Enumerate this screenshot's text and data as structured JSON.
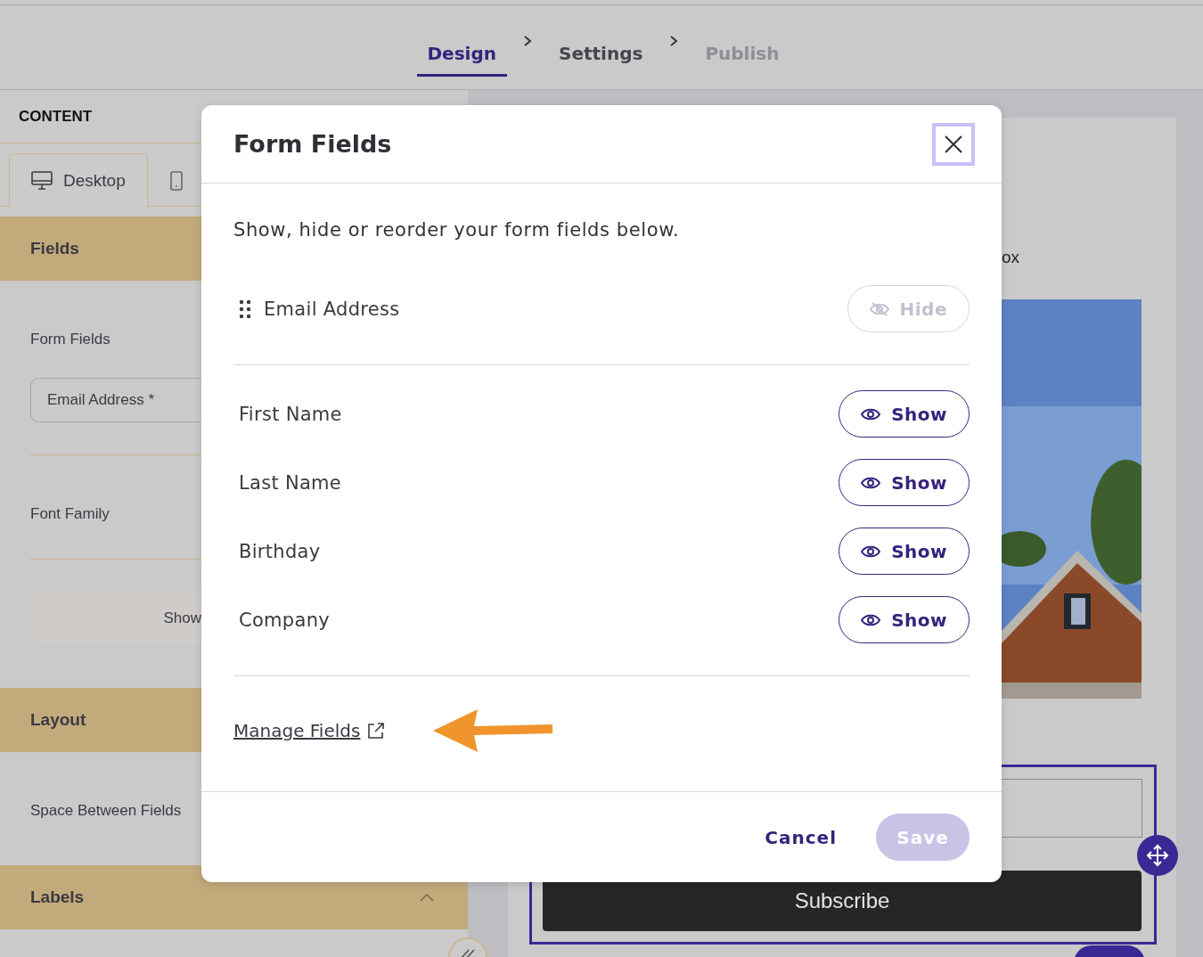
{
  "steps": [
    {
      "label": "Design",
      "selected": true,
      "disabled": false
    },
    {
      "label": "Settings",
      "selected": false,
      "disabled": false
    },
    {
      "label": "Publish",
      "selected": false,
      "disabled": true
    }
  ],
  "sidebar": {
    "title": "CONTENT",
    "device_tabs": [
      {
        "kind": "desktop",
        "label": "Desktop",
        "selected": true
      },
      {
        "kind": "mobile",
        "selected": false
      }
    ],
    "sections": [
      {
        "title": "Fields",
        "items": [
          {
            "kind": "label",
            "text": "Form Fields"
          },
          {
            "kind": "chip",
            "text": "Email Address *"
          },
          {
            "kind": "label",
            "text": "Font Family"
          },
          {
            "kind": "button",
            "text": "Show"
          }
        ]
      },
      {
        "title": "Layout",
        "items": [
          {
            "kind": "label",
            "text": "Space Between Fields"
          }
        ]
      },
      {
        "title": "Labels",
        "expanded": true
      }
    ]
  },
  "preview": {
    "partial_text": "ox",
    "button": "Subscribe"
  },
  "modal": {
    "title": "Form Fields",
    "description": "Show, hide or reorder your form fields below.",
    "fields": [
      {
        "label": "Email Address",
        "visible": true,
        "action": "Hide",
        "disabled": true
      },
      {
        "label": "First Name",
        "visible": false,
        "action": "Show",
        "disabled": false
      },
      {
        "label": "Last Name",
        "visible": false,
        "action": "Show",
        "disabled": false
      },
      {
        "label": "Birthday",
        "visible": false,
        "action": "Show",
        "disabled": false
      },
      {
        "label": "Company",
        "visible": false,
        "action": "Show",
        "disabled": false
      }
    ],
    "link": "Manage Fields",
    "cancel": "Cancel",
    "save": "Save",
    "save_disabled": true
  }
}
